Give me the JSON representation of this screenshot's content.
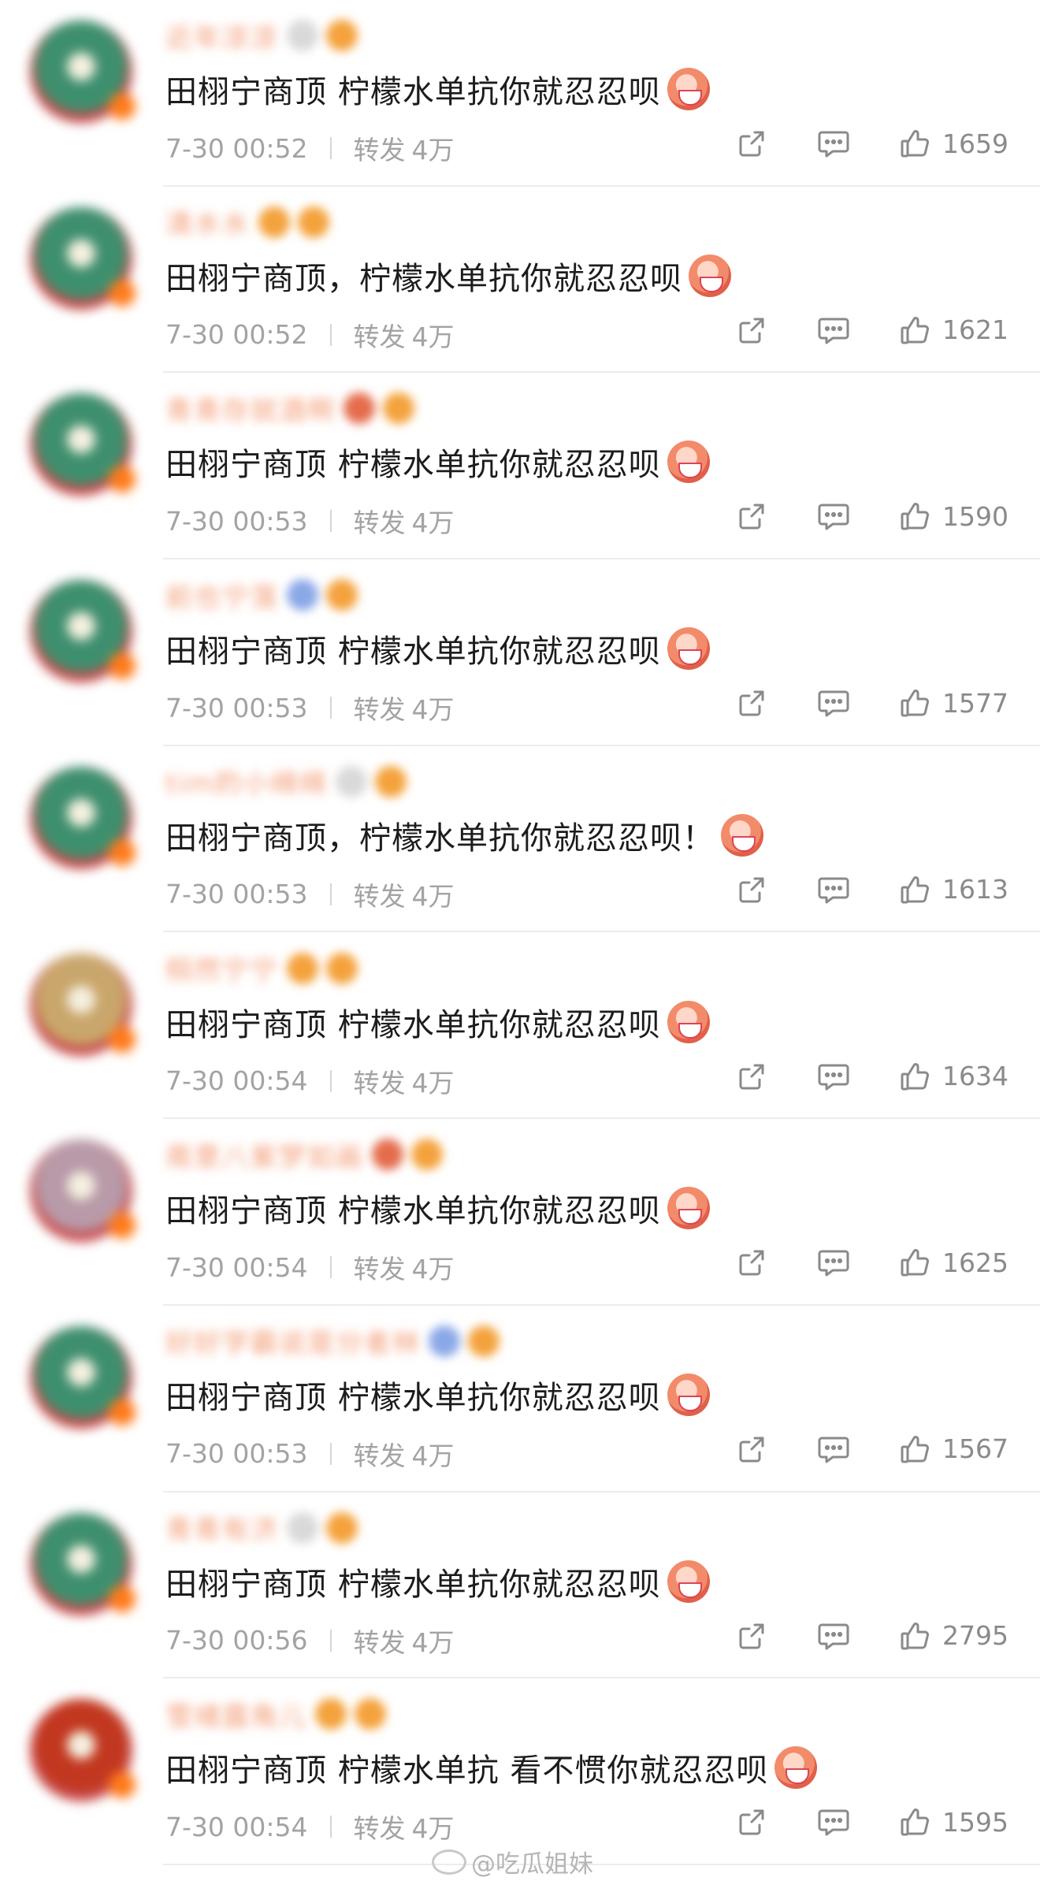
{
  "comments": [
    {
      "username": "近年凉凉",
      "content": "田栩宁商顶 柠檬水单抗你就忍忍呗",
      "time": "7-30 00:52",
      "repost_label": "转发",
      "repost_count": "4万",
      "likes": "1659",
      "avatar_color": "#3e8f6e"
    },
    {
      "username": "清水水",
      "content": "田栩宁商顶，柠檬水单抗你就忍忍呗",
      "time": "7-30 00:52",
      "repost_label": "转发",
      "repost_count": "4万",
      "likes": "1621",
      "avatar_color": "#3e8f6e"
    },
    {
      "username": "青青存就酒啊",
      "content": "田栩宁商顶 柠檬水单抗你就忍忍呗",
      "time": "7-30 00:53",
      "repost_label": "转发",
      "repost_count": "4万",
      "likes": "1590",
      "avatar_color": "#3e8f6e"
    },
    {
      "username": "前也宁落",
      "content": "田栩宁商顶 柠檬水单抗你就忍忍呗",
      "time": "7-30 00:53",
      "repost_label": "转发",
      "repost_count": "4万",
      "likes": "1577",
      "avatar_color": "#3e8f6e"
    },
    {
      "username": "tim的小绵绵",
      "content": "田栩宁商顶，柠檬水单抗你就忍忍呗！",
      "time": "7-30 00:53",
      "repost_label": "转发",
      "repost_count": "4万",
      "likes": "1613",
      "avatar_color": "#3e8f6e"
    },
    {
      "username": "栩然宁宁",
      "content": "田栩宁商顶 柠檬水单抗你就忍忍呗",
      "time": "7-30 00:54",
      "repost_label": "转发",
      "repost_count": "4万",
      "likes": "1634",
      "avatar_color": "#c9a66b"
    },
    {
      "username": "南意八紫梦如画",
      "content": "田栩宁商顶 柠檬水单抗你就忍忍呗",
      "time": "7-30 00:54",
      "repost_label": "转发",
      "repost_count": "4万",
      "likes": "1625",
      "avatar_color": "#b89aa8"
    },
    {
      "username": "好好学霸说是分者林",
      "content": "田栩宁商顶 柠檬水单抗你就忍忍呗",
      "time": "7-30 00:53",
      "repost_label": "转发",
      "repost_count": "4万",
      "likes": "1567",
      "avatar_color": "#3e8f6e"
    },
    {
      "username": "青青有济",
      "content": "田栩宁商顶 柠檬水单抗你就忍忍呗",
      "time": "7-30 00:56",
      "repost_label": "转发",
      "repost_count": "4万",
      "likes": "2795",
      "avatar_color": "#3e8f6e"
    },
    {
      "username": "雪绪露角儿",
      "content": "田栩宁商顶 柠檬水单抗 看不惯你就忍忍呗",
      "time": "7-30 00:54",
      "repost_label": "转发",
      "repost_count": "4万",
      "likes": "1595",
      "avatar_color": "#c2371f"
    }
  ],
  "watermark": {
    "text": "@吃瓜姐妹"
  },
  "icons": {
    "share": "share-icon",
    "comment": "comment-icon",
    "like": "like-icon",
    "sticker": "fan-sticker-icon"
  }
}
